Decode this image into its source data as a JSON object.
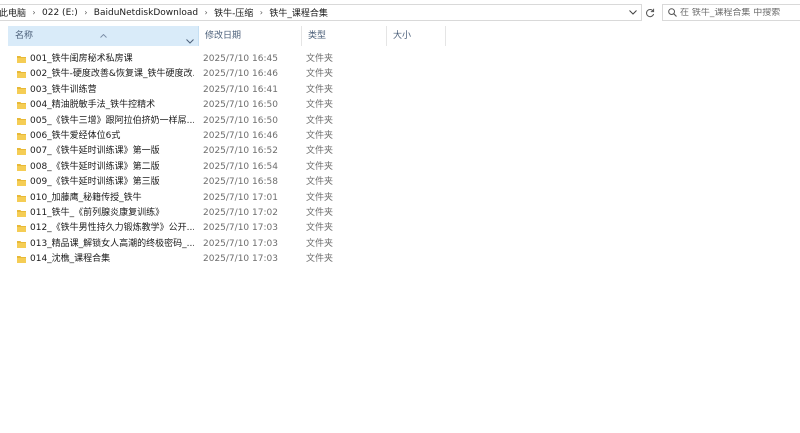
{
  "address": {
    "breadcrumbs": [
      "此电脑",
      "022 (E:)",
      "BaiduNetdiskDownload",
      "铁牛-压缩",
      "铁牛_课程合集"
    ]
  },
  "search": {
    "placeholder": "在 铁牛_课程合集 中搜索"
  },
  "columns": {
    "name": "名称",
    "date": "修改日期",
    "type": "类型",
    "size": "大小"
  },
  "files": [
    {
      "name": "001_铁牛闺房秘术私房课",
      "date": "2025/7/10 16:45",
      "type": "文件夹"
    },
    {
      "name": "002_铁牛-硬度改善&恢复课_铁牛硬度改...",
      "date": "2025/7/10 16:46",
      "type": "文件夹"
    },
    {
      "name": "003_铁牛训练营",
      "date": "2025/7/10 16:41",
      "type": "文件夹"
    },
    {
      "name": "004_精油脱敏手法_铁牛控精术",
      "date": "2025/7/10 16:50",
      "type": "文件夹"
    },
    {
      "name": "005_《铁牛三增》跟阿拉伯挤奶一样屌...",
      "date": "2025/7/10 16:50",
      "type": "文件夹"
    },
    {
      "name": "006_铁牛爱经体位6式",
      "date": "2025/7/10 16:46",
      "type": "文件夹"
    },
    {
      "name": "007_《铁牛延时训练课》第一版",
      "date": "2025/7/10 16:52",
      "type": "文件夹"
    },
    {
      "name": "008_《铁牛延时训练课》第二版",
      "date": "2025/7/10 16:54",
      "type": "文件夹"
    },
    {
      "name": "009_《铁牛延时训练课》第三版",
      "date": "2025/7/10 16:58",
      "type": "文件夹"
    },
    {
      "name": "010_加藤鹰_秘籍传授_铁牛",
      "date": "2025/7/10 17:01",
      "type": "文件夹"
    },
    {
      "name": "011_铁牛_《前列腺炎康复训练》",
      "date": "2025/7/10 17:02",
      "type": "文件夹"
    },
    {
      "name": "012_《铁牛男性持久力锻炼教学》公开...",
      "date": "2025/7/10 17:03",
      "type": "文件夹"
    },
    {
      "name": "013_精品课_解锁女人高潮的终极密码_...",
      "date": "2025/7/10 17:03",
      "type": "文件夹"
    },
    {
      "name": "014_沈樵_课程合集",
      "date": "2025/7/10 17:03",
      "type": "文件夹"
    }
  ],
  "colors": {
    "header_selected": "#d9ebf9",
    "folder": "#e8b937",
    "secondary_text": "#6d6d6d"
  },
  "icons": [
    "chevron-right-icon",
    "chevron-down-icon",
    "refresh-icon",
    "search-icon",
    "sort-up-icon",
    "folder-icon"
  ]
}
